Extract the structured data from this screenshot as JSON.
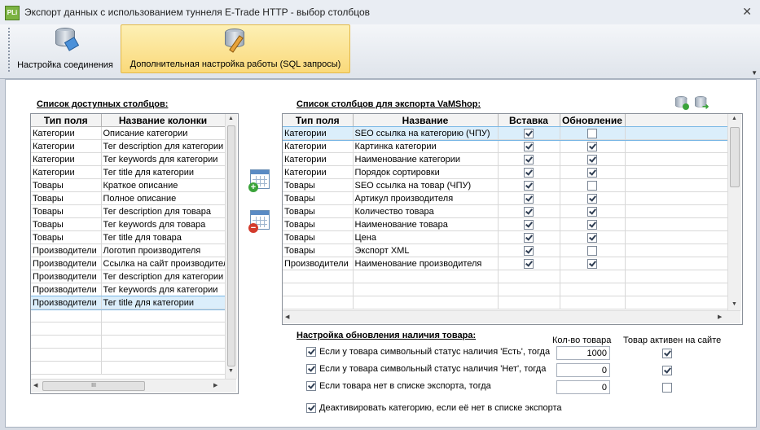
{
  "window": {
    "app_icon_text": "PLi",
    "title": "Экспорт данных с использованием туннеля E-Trade HTTP - выбор столбцов",
    "close_glyph": "✕"
  },
  "toolbar": {
    "buttons": [
      {
        "label": "Настройка соединения",
        "icon": "database-connection-icon",
        "active": false
      },
      {
        "label": "Дополнительная настройка работы (SQL запросы)",
        "icon": "database-edit-icon",
        "active": true
      }
    ]
  },
  "available": {
    "title": "Список доступных столбцов:",
    "columns": [
      "Тип поля",
      "Название колонки"
    ],
    "rows": [
      [
        "Категории",
        "Описание категории"
      ],
      [
        "Категории",
        "Тег description для категории"
      ],
      [
        "Категории",
        "Тег keywords для категории"
      ],
      [
        "Категории",
        "Тег title для категории"
      ],
      [
        "Товары",
        "Краткое описание"
      ],
      [
        "Товары",
        "Полное описание"
      ],
      [
        "Товары",
        "Тег description для товара"
      ],
      [
        "Товары",
        "Тег keywords для товара"
      ],
      [
        "Товары",
        "Тег title для товара"
      ],
      [
        "Производители",
        "Логотип производителя"
      ],
      [
        "Производители",
        "Ссылка на сайт производителя"
      ],
      [
        "Производители",
        "Тег description для категории"
      ],
      [
        "Производители",
        "Тег keywords для категории"
      ],
      [
        "Производители",
        "Тег title для категории"
      ]
    ],
    "selected_row": 13,
    "hscroll_grip": "III"
  },
  "export": {
    "title": "Список столбцов для экспорта VaMShop:",
    "columns": [
      "Тип поля",
      "Название",
      "Вставка",
      "Обновление"
    ],
    "rows": [
      {
        "type": "Категории",
        "name": "SEO ссылка на категорию (ЧПУ)",
        "insert": true,
        "update": false
      },
      {
        "type": "Категории",
        "name": "Картинка категории",
        "insert": true,
        "update": true
      },
      {
        "type": "Категории",
        "name": "Наименование категории",
        "insert": true,
        "update": true
      },
      {
        "type": "Категории",
        "name": "Порядок сортировки",
        "insert": true,
        "update": true
      },
      {
        "type": "Товары",
        "name": "SEO ссылка на товар (ЧПУ)",
        "insert": true,
        "update": false
      },
      {
        "type": "Товары",
        "name": "Артикул производителя",
        "insert": true,
        "update": true
      },
      {
        "type": "Товары",
        "name": "Количество товара",
        "insert": true,
        "update": true
      },
      {
        "type": "Товары",
        "name": "Наименование товара",
        "insert": true,
        "update": true
      },
      {
        "type": "Товары",
        "name": "Цена",
        "insert": true,
        "update": true
      },
      {
        "type": "Товары",
        "name": "Экспорт XML",
        "insert": true,
        "update": false
      },
      {
        "type": "Производители",
        "name": "Наименование производителя",
        "insert": true,
        "update": true
      }
    ],
    "selected_row": 0
  },
  "stock": {
    "title": "Настройка обновления наличия товара:",
    "col_qty": "Кол-во товара",
    "col_active": "Товар активен на сайте",
    "rows": [
      {
        "label": "Если у товара символьный статус наличия 'Есть', тогда",
        "checked": true,
        "qty": "1000",
        "active": true
      },
      {
        "label": "Если у товара символьный статус наличия 'Нет', тогда",
        "checked": true,
        "qty": "0",
        "active": true
      },
      {
        "label": "Если товара нет в списке экспорта, тогда",
        "checked": true,
        "qty": "0",
        "active": false
      }
    ],
    "deactivate": {
      "label": "Деактивировать категорию, если её нет в списке экспорта",
      "checked": true
    }
  }
}
